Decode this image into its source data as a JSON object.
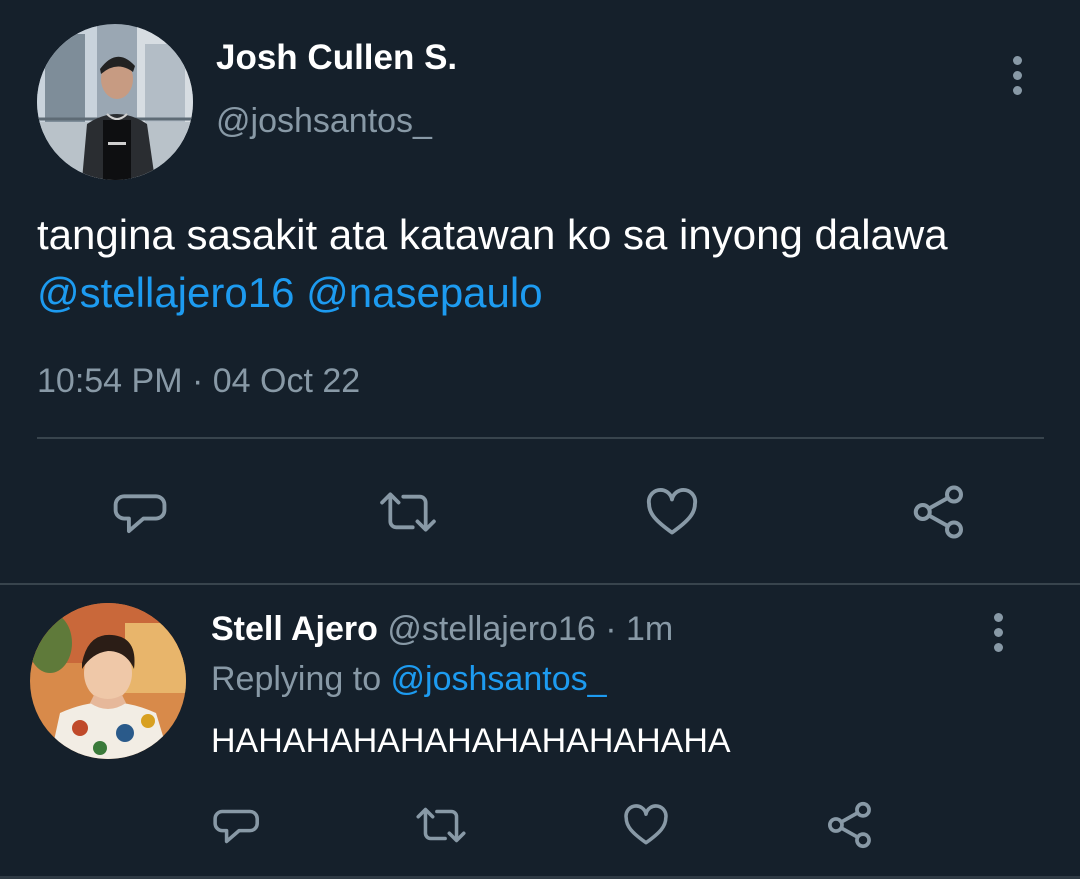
{
  "main_tweet": {
    "author_name": "Josh Cullen S.",
    "author_handle": "@joshsantos_",
    "text_before": "tangina sasakit ata katawan ko sa inyong dalawa ",
    "mention_1": "@stellajero16",
    "mention_2": "@nasepaulo",
    "timestamp": "10:54 PM · 04 Oct 22",
    "actions": [
      "reply-icon",
      "retweet-icon",
      "like-icon",
      "share-icon"
    ]
  },
  "reply_tweet": {
    "author_name": "Stell Ajero",
    "author_handle_time": "@stellajero16 · 1m",
    "replying_to_label": "Replying to ",
    "replying_to_handle": "@joshsantos_",
    "text": "HAHAHAHAHAHAHAHAHAHAHA",
    "actions": [
      "reply-icon",
      "retweet-icon",
      "like-icon",
      "share-icon"
    ]
  },
  "colors": {
    "background": "#15202b",
    "secondary_text": "#8899a6",
    "accent": "#1d9bf0",
    "divider": "#38444d"
  }
}
